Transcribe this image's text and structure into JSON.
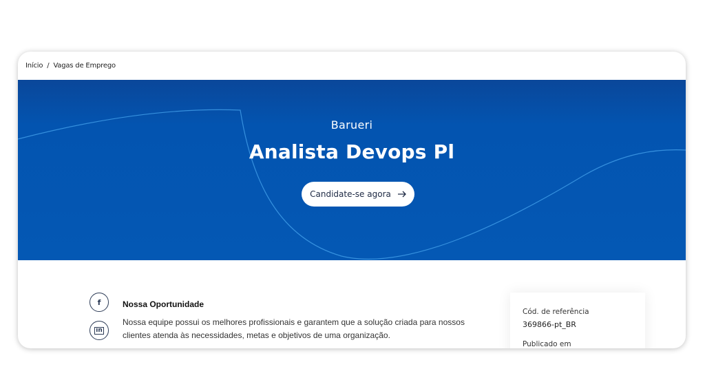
{
  "breadcrumb": {
    "home": "Início",
    "separator": "/",
    "current": "Vagas de Emprego"
  },
  "hero": {
    "location": "Barueri",
    "title": "Analista Devops Pl",
    "apply_label": "Candidate-se agora",
    "background_color": "#0458b4",
    "wave_color": "#3f9be6"
  },
  "social": [
    {
      "icon": "facebook-icon",
      "glyph": "f"
    },
    {
      "icon": "linkedin-icon",
      "glyph": "in"
    }
  ],
  "opportunity": {
    "title": "Nossa Oportunidade",
    "text": "Nossa equipe possui os melhores profissionais e garantem que a solução criada para nossos clientes atenda às necessidades, metas e objetivos de uma organização."
  },
  "details": {
    "ref_label": "Cód. de referência",
    "ref_value": "369866-pt_BR",
    "published_label": "Publicado em"
  }
}
